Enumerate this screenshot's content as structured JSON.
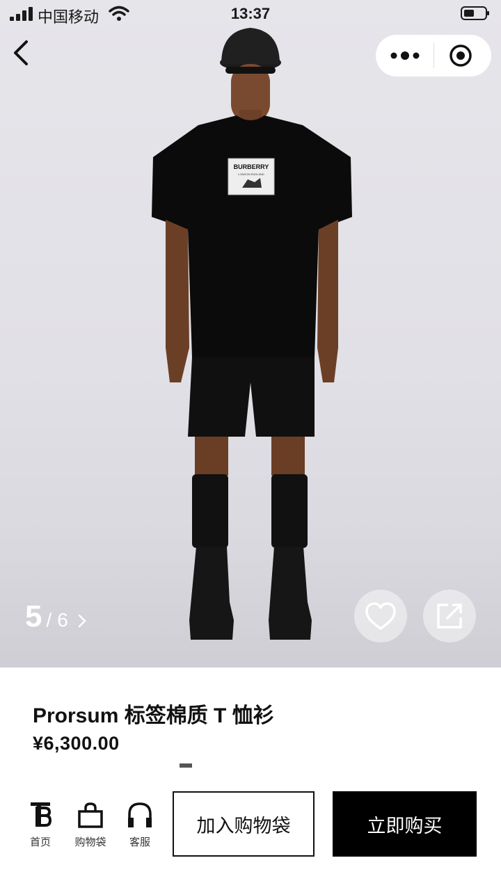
{
  "status_bar": {
    "carrier": "中国移动",
    "time": "13:37"
  },
  "nav": {
    "back_icon": "chevron-left-icon",
    "more_icon": "more-dots-icon",
    "close_icon": "target-circle-icon"
  },
  "gallery": {
    "current": "5",
    "separator": "/",
    "total": "6",
    "shirt_label_brand": "BURBERRY",
    "shirt_label_sub": "LONDON ENGLAND"
  },
  "product": {
    "title": "Prorsum 标签棉质 T 恤衫",
    "price": "¥6,300.00"
  },
  "bottom_bar": {
    "home_label": "首页",
    "bag_label": "购物袋",
    "service_label": "客服",
    "add_to_bag": "加入购物袋",
    "buy_now": "立即购买"
  },
  "colors": {
    "primary": "#000000",
    "background": "#ffffff",
    "hero_bg": "#e3e2e7"
  }
}
